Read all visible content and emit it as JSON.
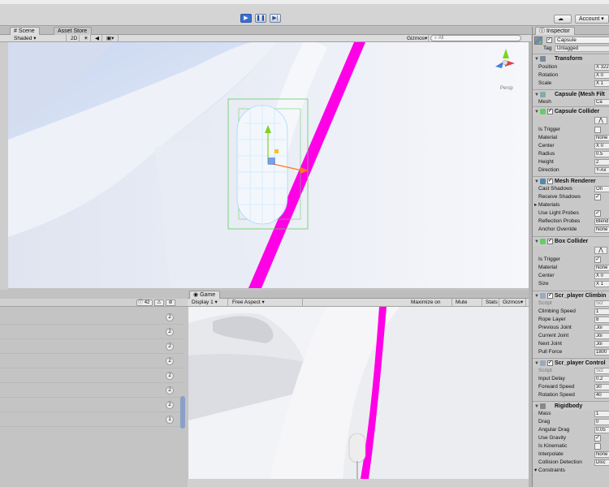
{
  "toolbar": {
    "play_icon": "play-icon",
    "pause_icon": "pause-icon",
    "step_icon": "step-icon",
    "cloud_icon": "cloud-icon",
    "account_label": "Account"
  },
  "scene_panel": {
    "tabs": [
      {
        "label": "Scene"
      },
      {
        "label": "Asset Store"
      }
    ],
    "shading": "Shaded",
    "mode_2d": "2D",
    "gizmos": "Gizmos",
    "search_placeholder": "All",
    "persp_label": "Persp"
  },
  "inspector": {
    "tab_label": "Inspector",
    "object_name": "Capsule",
    "tag_label": "Tag",
    "tag_value": "Untagged",
    "transform": {
      "title": "Transform",
      "rows": [
        {
          "label": "Position",
          "value": "X 322"
        },
        {
          "label": "Rotation",
          "value": "X 0"
        },
        {
          "label": "Scale",
          "value": "X 1"
        }
      ]
    },
    "mesh_filter": {
      "title": "Capsule (Mesh Filt",
      "mesh_label": "Mesh",
      "mesh_value": "Ca"
    },
    "capsule_collider": {
      "title": "Capsule Collider",
      "rows": [
        {
          "label": "Is Trigger",
          "value": ""
        },
        {
          "label": "Material",
          "value": "None"
        },
        {
          "label": "Center",
          "value": "X 0"
        },
        {
          "label": "Radius",
          "value": "0.5"
        },
        {
          "label": "Height",
          "value": "2"
        },
        {
          "label": "Direction",
          "value": "Y-Ax"
        }
      ]
    },
    "mesh_renderer": {
      "title": "Mesh Renderer",
      "rows": [
        {
          "label": "Cast Shadows",
          "value": "On"
        },
        {
          "label": "Receive Shadows",
          "value": "✓"
        },
        {
          "label": "Materials",
          "value": ""
        },
        {
          "label": "Use Light Probes",
          "value": "✓"
        },
        {
          "label": "Reflection Probes",
          "value": "Blend"
        },
        {
          "label": "Anchor Override",
          "value": "None"
        }
      ]
    },
    "box_collider": {
      "title": "Box Collider",
      "rows": [
        {
          "label": "Is Trigger",
          "value": "✓"
        },
        {
          "label": "Material",
          "value": "None"
        },
        {
          "label": "Center",
          "value": "X 0"
        },
        {
          "label": "Size",
          "value": "X 1"
        }
      ]
    },
    "climbing": {
      "title": "Scr_player Climbin",
      "rows": [
        {
          "label": "Script",
          "value": "Scr"
        },
        {
          "label": "Climbing Speed",
          "value": "1"
        },
        {
          "label": "Rope Layer",
          "value": "8"
        },
        {
          "label": "Previous Joint",
          "value": "Joi"
        },
        {
          "label": "Current Joint",
          "value": "Joi"
        },
        {
          "label": "Next Joint",
          "value": "Joi"
        },
        {
          "label": "Pull Force",
          "value": "1800"
        }
      ]
    },
    "control": {
      "title": "Scr_player Control",
      "rows": [
        {
          "label": "Script",
          "value": "Scr"
        },
        {
          "label": "Input Delay",
          "value": "0.2"
        },
        {
          "label": "Forward Speed",
          "value": "30"
        },
        {
          "label": "Rotation Speed",
          "value": "40"
        }
      ]
    },
    "rigidbody": {
      "title": "Rigidbody",
      "rows": [
        {
          "label": "Mass",
          "value": "1"
        },
        {
          "label": "Drag",
          "value": "0"
        },
        {
          "label": "Angular Drag",
          "value": "0.05"
        },
        {
          "label": "Use Gravity",
          "value": "✓"
        },
        {
          "label": "Is Kinematic",
          "value": ""
        },
        {
          "label": "Interpolate",
          "value": "None"
        },
        {
          "label": "Collision Detection",
          "value": "Disc"
        },
        {
          "label": "Constraints",
          "value": ""
        }
      ]
    }
  },
  "hierarchy": {
    "count_badge": "42",
    "rows": [
      {
        "badge": "2"
      },
      {
        "badge": "2"
      },
      {
        "badge": "2"
      },
      {
        "badge": "2"
      },
      {
        "badge": "2"
      },
      {
        "badge": "2"
      },
      {
        "badge": "2"
      },
      {
        "badge": "1"
      }
    ]
  },
  "game_panel": {
    "tab_label": "Game",
    "display": "Display 1",
    "aspect": "Free Aspect",
    "maximize": "Maximize on Play",
    "mute": "Mute audio",
    "stats": "Stats",
    "gizmos": "Gizmos"
  }
}
